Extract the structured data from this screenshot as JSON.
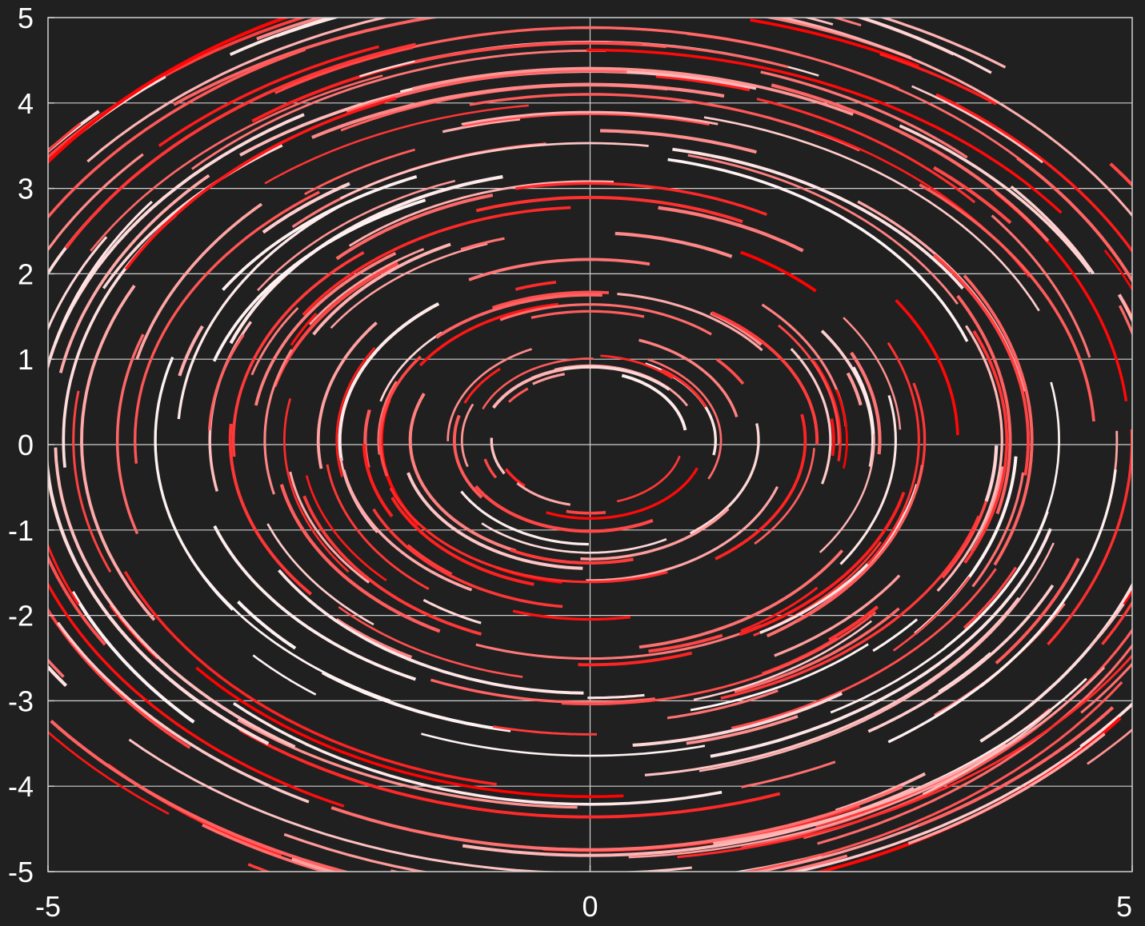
{
  "chart_data": {
    "type": "line",
    "title": "",
    "xlabel": "",
    "ylabel": "",
    "xlim": [
      -5,
      5
    ],
    "ylim": [
      -5,
      5
    ],
    "x_ticks": [
      "-5",
      "0",
      "5"
    ],
    "y_ticks": [
      "5",
      "4",
      "3",
      "2",
      "1",
      "0",
      "-1",
      "-2",
      "-3",
      "-4",
      "-5"
    ],
    "grid": true,
    "background_color": "#202020",
    "grid_color": "#d0d0d0",
    "text_color": "#ffffff",
    "colormap": [
      "#ff0000",
      "#ffffff"
    ],
    "series_description": "concentric arc segments, circular flow field"
  }
}
